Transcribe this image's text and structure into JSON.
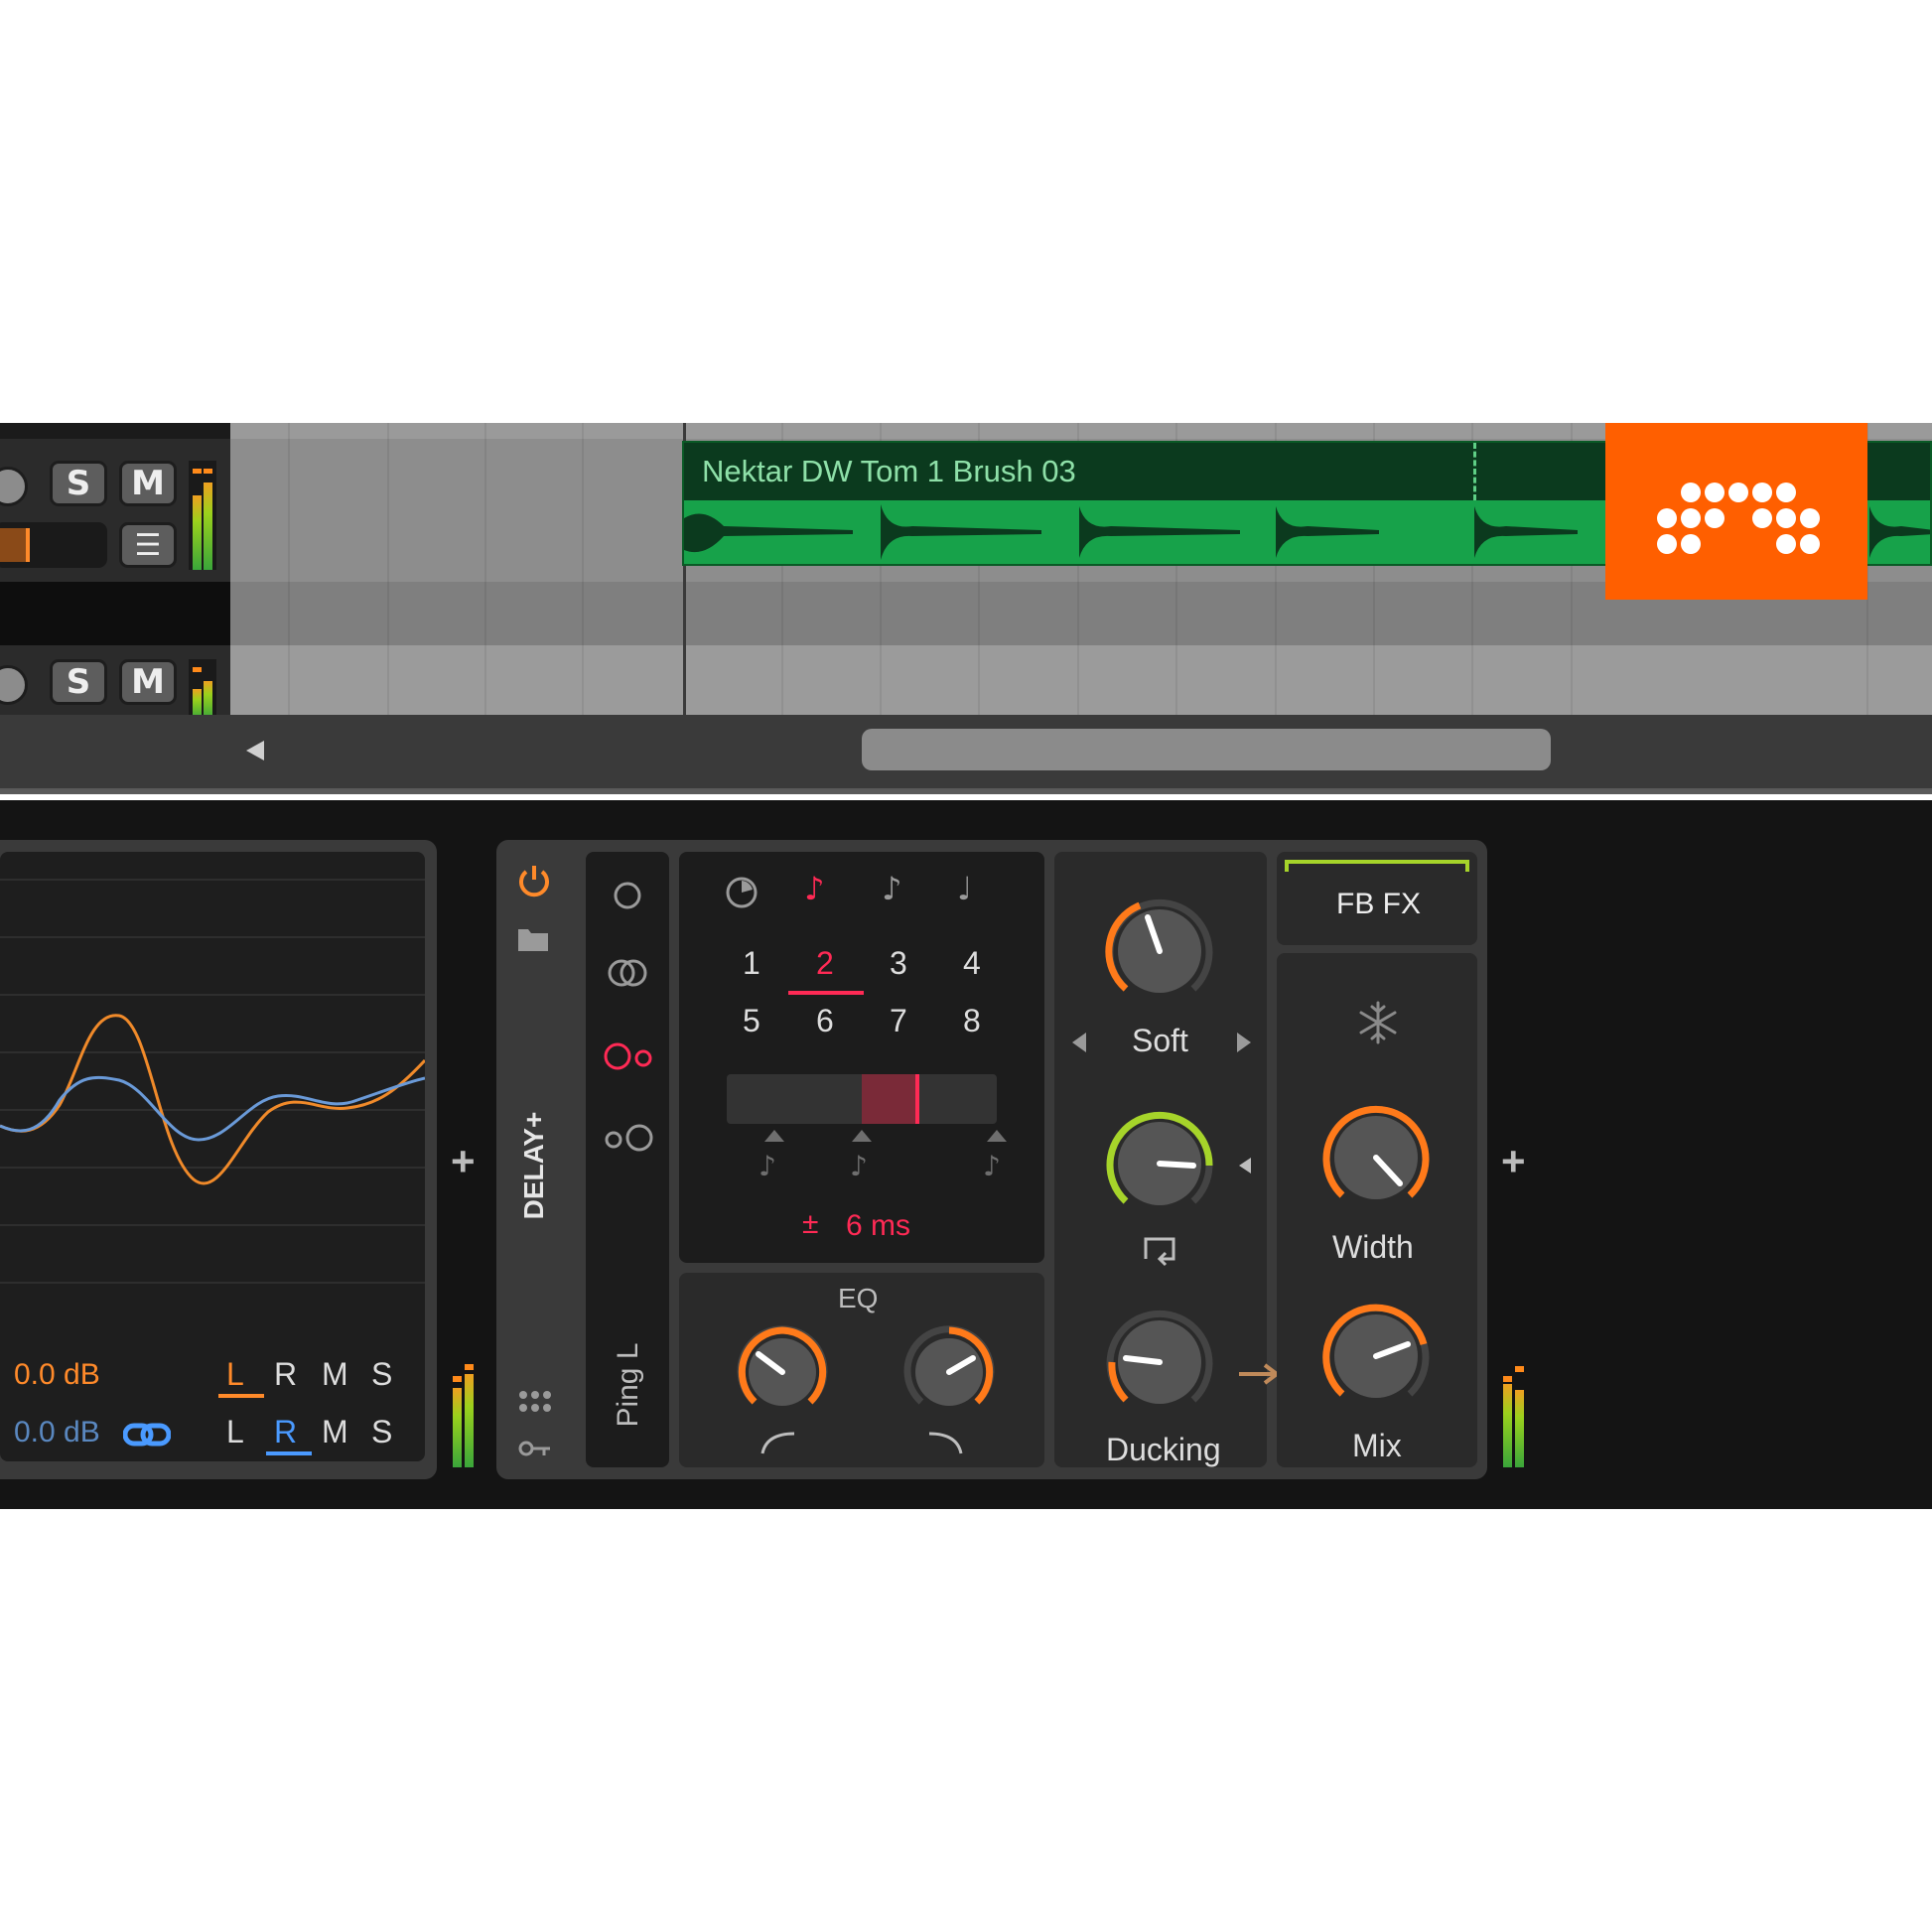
{
  "arranger": {
    "track1": {
      "solo_label": "S",
      "mute_label": "M"
    },
    "track2": {
      "solo_label": "S",
      "mute_label": "M"
    },
    "clip_title": "Nektar DW Tom 1 Brush 03"
  },
  "colors": {
    "accent_orange": "#ff7a1a",
    "accent_red": "#ff2a55",
    "accent_green": "#a6d42a",
    "clip_green": "#17a24a",
    "brand_orange": "#ff5f00"
  },
  "scope": {
    "gain_left": "0.0 dB",
    "gain_right": "0.0 dB",
    "row1_channels": [
      "L",
      "R",
      "M",
      "S"
    ],
    "row2_channels": [
      "L",
      "R",
      "M",
      "S"
    ],
    "row1_selected": "L",
    "row2_selected": "R"
  },
  "delay": {
    "device_name": "DELAY+",
    "preset_name": "Ping L",
    "numbers": [
      "1",
      "2",
      "3",
      "4",
      "5",
      "6",
      "7",
      "8"
    ],
    "selected_number": "2",
    "offset_sign": "±",
    "offset_value": "6 ms",
    "eq_label": "EQ",
    "saturation_mode": "Soft",
    "ducking_label": "Ducking",
    "fb_fx_label": "FB FX",
    "width_label": "Width",
    "mix_label": "Mix",
    "freeze_icon": "snowflake-icon"
  },
  "add_device_label": "+"
}
